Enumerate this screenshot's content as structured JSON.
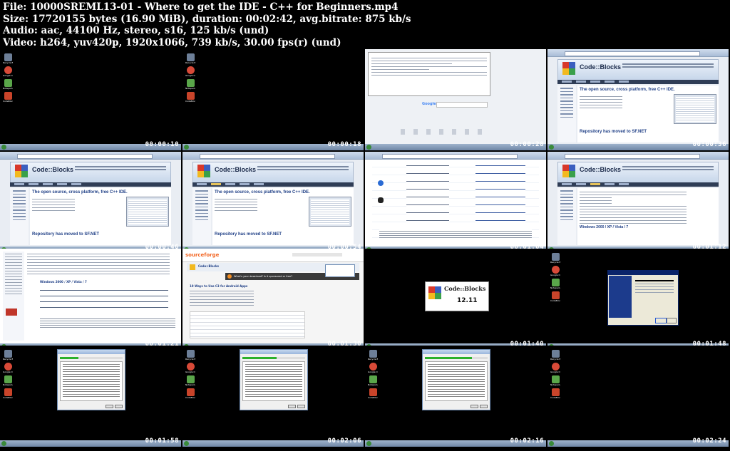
{
  "header": {
    "file_line": "File: 10000SREML13-01 - Where to get the IDE - C++ for Beginners.mp4",
    "size_line": "Size: 17720155 bytes (16.90 MiB), duration: 00:02:42, avg.bitrate: 875 kb/s",
    "audio_line": "Audio: aac, 44100 Hz, stereo, s16, 125 kb/s (und)",
    "video_line": "Video: h264, yuv420p, 1920x1066, 739 kb/s, 30.00 fps(r) (und)"
  },
  "timestamps": [
    "00:00:10",
    "00:00:18",
    "00:00:28",
    "00:00:36",
    "00:00:46",
    "00:00:54",
    "00:01:04",
    "00:01:12",
    "00:01:21",
    "00:01:30",
    "00:01:40",
    "00:01:48",
    "00:01:58",
    "00:02:06",
    "00:02:16",
    "00:02:24"
  ],
  "webpage": {
    "site_title": "Code::Blocks",
    "headline": "The open source, cross platform, free C++ IDE.",
    "subheadline": "Repository has moved to SF.NET",
    "windows_heading": "Windows 2000 / XP / Vista / 7",
    "sourceforge_logo": "sourceforge",
    "sf_ad_title": "10 Ways to Use C3 for Android Apps",
    "sf_banner": "What's your download? Is it sponsored or free?"
  },
  "splash": {
    "version": "12.11",
    "logo_text": "Code::Blocks"
  },
  "desktop_icons": [
    {
      "label": "Recycle Bin",
      "color": "#6d7f98"
    },
    {
      "label": "Google Chrome",
      "color": "#d84a38"
    },
    {
      "label": "Notepad++",
      "color": "#5aa64a"
    },
    {
      "label": "CodeBlocks",
      "color": "#c9442a"
    }
  ],
  "colors": {
    "background": "#000000",
    "cb_logo": [
      "#d8382a",
      "#3b5fbf",
      "#f2b91f",
      "#3aa04a"
    ]
  }
}
